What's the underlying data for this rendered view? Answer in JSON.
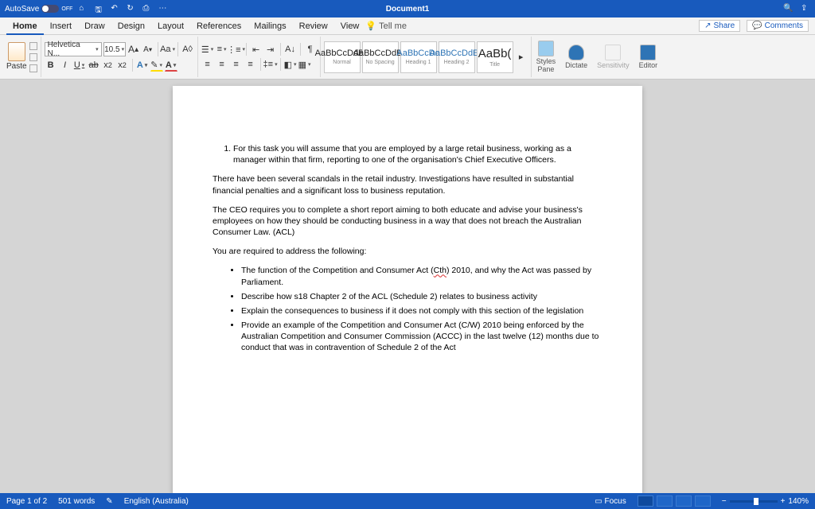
{
  "titlebar": {
    "autosave": "AutoSave",
    "off": "OFF",
    "docname": "Document1"
  },
  "tabs": [
    "Home",
    "Insert",
    "Draw",
    "Design",
    "Layout",
    "References",
    "Mailings",
    "Review",
    "View"
  ],
  "tellme": "Tell me",
  "share": "Share",
  "comments": "Comments",
  "font": {
    "name": "Helvetica N...",
    "size": "10.5"
  },
  "paste": "Paste",
  "fontbtns1": {
    "growA": "A▴",
    "shrinkA": "A▾",
    "Aa": "Aa",
    "clear": "A◊"
  },
  "fontbtns2": {
    "B": "B",
    "I": "I",
    "U": "U",
    "ab": "ab",
    "x2": "x₂",
    "x2u": "x²"
  },
  "styles": [
    {
      "preview": "AaBbCcDdEe",
      "label": "Normal"
    },
    {
      "preview": "AaBbCcDdEe",
      "label": "No Spacing"
    },
    {
      "preview": "AaBbCcDd",
      "label": "Heading 1"
    },
    {
      "preview": "AaBbCcDdEe",
      "label": "Heading 2"
    },
    {
      "preview": "AaBb(",
      "label": "Title"
    }
  ],
  "panes": {
    "styles": "Styles\nPane",
    "dictate": "Dictate",
    "sens": "Sensitivity",
    "editor": "Editor"
  },
  "doc": {
    "li1": "For this task you will assume that you are employed by a large retail business, working as a manager within that firm, reporting to one of the organisation's Chief Executive Officers.",
    "p1": "There have been several scandals in the retail industry. Investigations have resulted in substantial financial penalties and a significant loss to business reputation.",
    "p2": "The CEO requires you to complete a short report aiming to both educate and advise your business's employees on how they should be conducting business in a way that does not breach the Australian Consumer Law. (ACL)",
    "p3": "You are required to address the following:",
    "b1a": "The function of the Competition and Consumer Act (",
    "b1b": "Cth",
    "b1c": ") 2010, and why the Act was passed by Parliament.",
    "b2": "Describe how s18 Chapter 2 of the ACL (Schedule 2) relates to business activity",
    "b3": "Explain the consequences to business if it does not comply with this section of the legislation",
    "b4": "Provide an example of the Competition and Consumer Act (C/W) 2010 being enforced by the Australian Competition and Consumer Commission (ACCC) in the last twelve (12) months due to conduct that was in contravention of Schedule 2 of the Act"
  },
  "status": {
    "page": "Page 1 of 2",
    "words": "501 words",
    "lang": "English (Australia)",
    "focus": "Focus",
    "zoom": "140%"
  }
}
